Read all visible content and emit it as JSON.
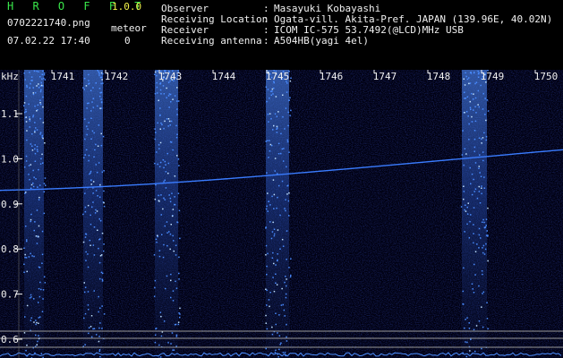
{
  "app": {
    "name": "H R O F F T",
    "version": "1.0.0"
  },
  "file": {
    "name": "0702221740.png",
    "datetime": "07.02.22 17:40"
  },
  "meteor": {
    "label": "meteor",
    "count": "0"
  },
  "info": {
    "observer": {
      "key": "Observer",
      "value": "Masayuki Kobayashi"
    },
    "location": {
      "key": "Receiving Location",
      "value": "Ogata-vill. Akita-Pref. JAPAN (139.96E, 40.02N)"
    },
    "receiver": {
      "key": "Receiver",
      "value": "ICOM IC-575 53.7492(@LCD)MHz USB"
    },
    "antenna": {
      "key": "Receiving antenna",
      "value": "A504HB(yagi 4el)"
    }
  },
  "colors": {
    "label": "#39e64a",
    "version": "#f2f24a",
    "info": "#f0f0f0",
    "signal": "#3a7cff",
    "background": "#000010"
  },
  "spectrogram": {
    "unit": "kHz",
    "time_labels": [
      "1741",
      "1742",
      "1743",
      "1744",
      "1745",
      "1746",
      "1747",
      "1748",
      "1749",
      "1750"
    ],
    "freq_labels": [
      {
        "label": "1.1",
        "value": 1.1
      },
      {
        "label": "1.0",
        "value": 1.0
      },
      {
        "label": "0.9",
        "value": 0.9
      },
      {
        "label": "0.8",
        "value": 0.8
      },
      {
        "label": "0.7",
        "value": 0.7
      },
      {
        "label": "0.6",
        "value": 0.6
      }
    ],
    "carrier_khz": {
      "start": 0.93,
      "end": 1.02
    }
  }
}
